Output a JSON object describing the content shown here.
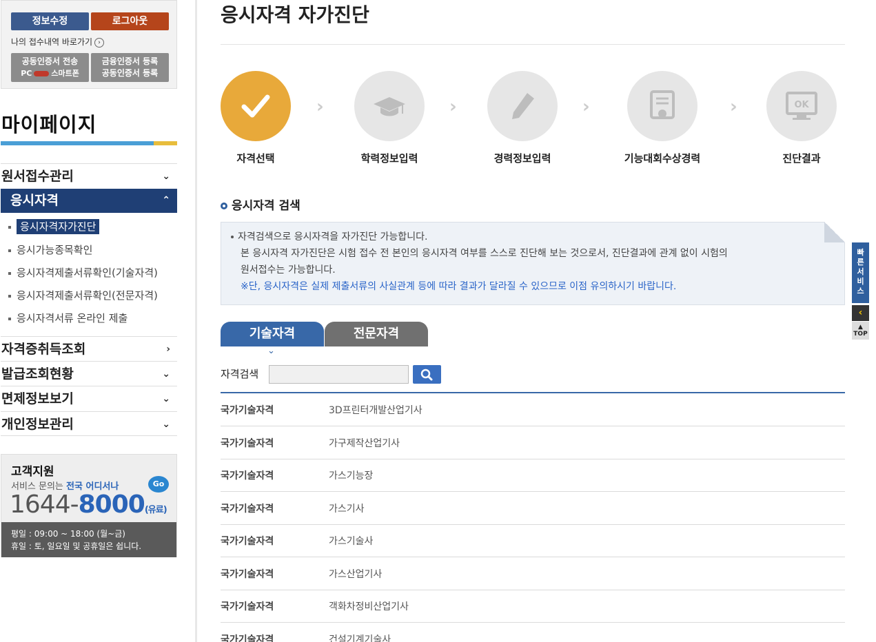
{
  "sidebar": {
    "login": {
      "edit_label": "정보수정",
      "logout_label": "로그아웃",
      "receipt_link": "나의 접수내역 바로가기",
      "cert_transfer_line1": "공동인증서 전송",
      "cert_transfer_pc": "PC",
      "cert_transfer_phone": "스마트폰",
      "cert_register_line1": "금융인증서 등록",
      "cert_register_line2": "공동인증서 등록"
    },
    "title": "마이페이지",
    "menu": [
      {
        "label": "원서접수관리",
        "chev": "⌄"
      },
      {
        "label": "응시자격",
        "chev": "⌃"
      },
      {
        "label": "자격증취득조회",
        "chev": "›"
      },
      {
        "label": "발급조회현황",
        "chev": "⌄"
      },
      {
        "label": "면제정보보기",
        "chev": "⌄"
      },
      {
        "label": "개인정보관리",
        "chev": "⌄"
      }
    ],
    "submenu": [
      "응시자격자가진단",
      "응시가능종목확인",
      "응시자격제출서류확인(기술자격)",
      "응시자격제출서류확인(전문자격)",
      "응시자격서류 온라인 제출"
    ],
    "support": {
      "title": "고객지원",
      "sub_prefix": "서비스 문의는",
      "sub_highlight": "전국 어디서나",
      "go": "Go",
      "phone_a": "1644",
      "phone_dash": "-",
      "phone_b": "8000",
      "paid": "(유료)",
      "hours1": "평일 : 09:00 ~ 18:00 (월~금)",
      "hours2": "휴일 : 토, 일요일 및 공휴일은 쉽니다."
    }
  },
  "main": {
    "title": "응시자격 자가진단",
    "steps": [
      "자격선택",
      "학력정보입력",
      "경력정보입력",
      "기능대회수상경력",
      "진단결과"
    ],
    "section_title": "응시자격 검색",
    "info": {
      "line1": "자격검색으로 응시자격을 자가진단 가능합니다.",
      "line2": "본 응시자격 자가진단은 시험 접수 전 본인의 응시자격 여부를 스스로 진단해 보는 것으로서, 진단결과에 관계 없이 시험의",
      "line3": "원서접수는 가능합니다.",
      "note": "※단, 응시자격은 실제 제출서류의 사실관계 등에 따라 결과가 달라질 수 있으므로 이점 유의하시기 바랍니다."
    },
    "tabs": [
      "기술자격",
      "전문자격"
    ],
    "search_label": "자격검색",
    "search_value": "",
    "results": [
      {
        "category": "국가기술자격",
        "name": "3D프린터개발산업기사"
      },
      {
        "category": "국가기술자격",
        "name": "가구제작산업기사"
      },
      {
        "category": "국가기술자격",
        "name": "가스기능장"
      },
      {
        "category": "국가기술자격",
        "name": "가스기사"
      },
      {
        "category": "국가기술자격",
        "name": "가스기술사"
      },
      {
        "category": "국가기술자격",
        "name": "가스산업기사"
      },
      {
        "category": "국가기술자격",
        "name": "객화차정비산업기사"
      },
      {
        "category": "국가기술자격",
        "name": "건설기계기술사"
      }
    ]
  },
  "quick": {
    "label_chars": [
      "빠",
      "른",
      "서",
      "비",
      "스"
    ],
    "arrow": "‹",
    "top": "TOP"
  }
}
